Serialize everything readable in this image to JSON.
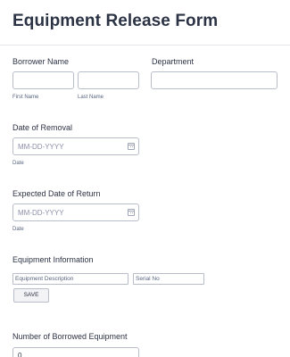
{
  "form": {
    "title": "Equipment Release Form"
  },
  "borrower": {
    "label": "Borrower Name",
    "first_sublabel": "First Name",
    "last_sublabel": "Last Name"
  },
  "department": {
    "label": "Department"
  },
  "removal": {
    "label": "Date of Removal",
    "placeholder": "MM-DD-YYYY",
    "sublabel": "Date"
  },
  "return": {
    "label": "Expected Date of Return",
    "placeholder": "MM-DD-YYYY",
    "sublabel": "Date"
  },
  "equipment": {
    "label": "Equipment Information",
    "description_placeholder": "Equipment Description",
    "serial_placeholder": "Serial No",
    "save_label": "SAVE"
  },
  "count": {
    "label": "Number of Borrowed Equipment",
    "value": "0"
  }
}
